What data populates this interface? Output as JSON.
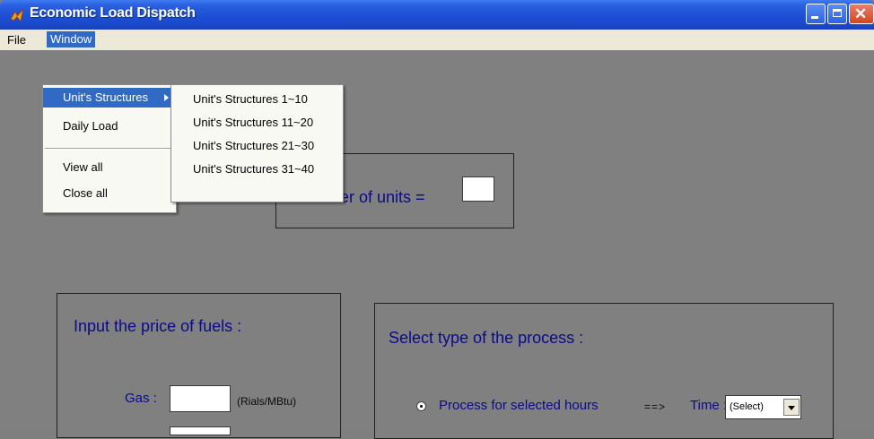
{
  "window": {
    "title": "Economic Load Dispatch",
    "icon": "matlab-icon",
    "controls": [
      "minimize-icon",
      "maximize-icon",
      "close-icon"
    ]
  },
  "menubar": {
    "file": "File",
    "window": "Window"
  },
  "window_menu": {
    "items": [
      {
        "label": "Unit's Structures",
        "has_submenu": true,
        "highlighted": true
      },
      {
        "label": "Daily Load"
      },
      {
        "label": "View all"
      },
      {
        "label": "Close all"
      }
    ],
    "submenu": [
      "Unit's Structures 1~10",
      "Unit's Structures 11~20",
      "Unit's Structures 21~30",
      "Unit's Structures 31~40"
    ]
  },
  "units_panel": {
    "label": "er of units  =",
    "value": ""
  },
  "fuels_panel": {
    "title": "Input the price of fuels :",
    "gas_label": "Gas :",
    "gas_value": "",
    "gas_unit": "(Rials/MBtu)"
  },
  "process_panel": {
    "title": "Select type of the process :",
    "radio_label": "Process for selected hours",
    "radio_selected": true,
    "arrow": "==>",
    "time_label": "Time :",
    "time_select": "(Select)"
  },
  "colors": {
    "titlebar": "#1d4fd6",
    "menu_highlight": "#316ac5",
    "figure_bg": "#808080",
    "label_text": "#0a0a8c"
  }
}
